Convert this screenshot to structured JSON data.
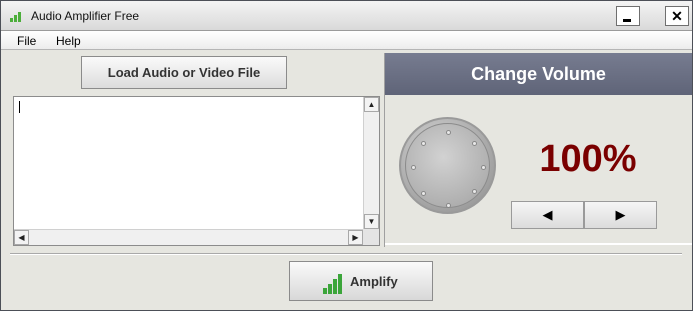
{
  "window": {
    "title": "Audio Amplifier Free",
    "close_glyph": "✕"
  },
  "menu": {
    "file": "File",
    "help": "Help"
  },
  "left": {
    "load_button": "Load Audio or Video File"
  },
  "scrollbars": {
    "up": "▲",
    "down": "▼",
    "left": "◀",
    "right": "▶"
  },
  "volume": {
    "header": "Change Volume",
    "percent": "100%",
    "decrease_glyph": "◀",
    "increase_glyph": "▶"
  },
  "amplify": {
    "label": "Amplify"
  },
  "icons": {
    "app": "equalizer-bars-icon",
    "amplify": "equalizer-bars-icon",
    "knob": "volume-knob"
  },
  "colors": {
    "accent_green": "#3ba53a",
    "percent_red": "#7a0000",
    "header_bg": "#6b7084"
  }
}
